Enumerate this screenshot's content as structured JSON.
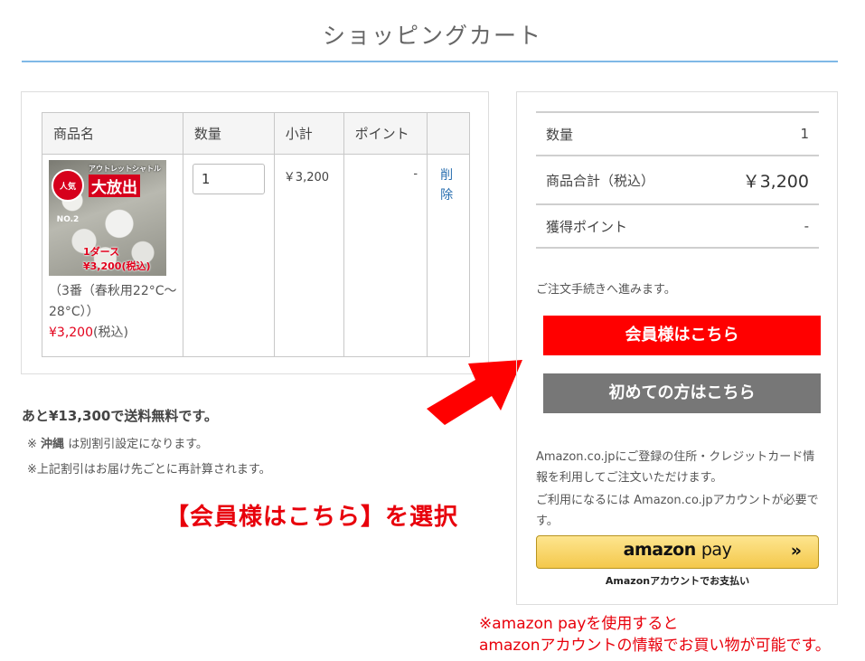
{
  "page": {
    "title": "ショッピングカート"
  },
  "cart": {
    "headers": {
      "product": "商品名",
      "quantity": "数量",
      "subtotal": "小計",
      "points": "ポイント",
      "actions": ""
    },
    "item": {
      "image_badge": "人気NO.2",
      "image_top_text": "アウトレットシャトル",
      "image_big_text": "大放出",
      "image_price": "1ダース ¥3,200(税込)",
      "name": "（3番（春秋用22°C～28°C））",
      "price": "¥3,200",
      "price_tax": "(税込)",
      "quantity": "1",
      "subtotal": "￥3,200",
      "points": "-",
      "delete_label": "削除"
    }
  },
  "shipping": {
    "free_shipping_text": "あと¥13,300で送料無料です。",
    "note1_prefix": "※",
    "note1_bold": "沖縄",
    "note1_suffix": "は別割引設定になります。",
    "note2": "※上記割引はお届け先ごとに再計算されます。"
  },
  "instruction": "【会員様はこちら】を選択",
  "summary": {
    "quantity_label": "数量",
    "quantity_value": "1",
    "total_label": "商品合計（税込）",
    "total_value": "￥3,200",
    "points_label": "獲得ポイント",
    "points_value": "-",
    "proceed_text": "ご注文手続きへ進みます。",
    "member_button": "会員様はこちら",
    "first_time_button": "初めての方はこちら",
    "amazon_text1": "Amazon.co.jpにご登録の住所・クレジットカード情報を利用してご注文いただけます。",
    "amazon_text2": "ご利用になるには Amazon.co.jpアカウントが必要です。",
    "amazon_logo_a": "amazon",
    "amazon_logo_b": "pay",
    "amazon_chevron": "»",
    "amazon_sub": "Amazonアカウントでお支払い"
  },
  "amazon_note": {
    "line1": "※amazon payを使用すると",
    "line2": "amazonアカウントの情報でお買い物が可能です。"
  },
  "colors": {
    "accent_red": "#ff0000",
    "gray_button": "#777777",
    "title_rule": "#7fb8e6",
    "annotation_red": "#e8000b"
  },
  "icons": {
    "arrow": "red-arrow-icon"
  }
}
